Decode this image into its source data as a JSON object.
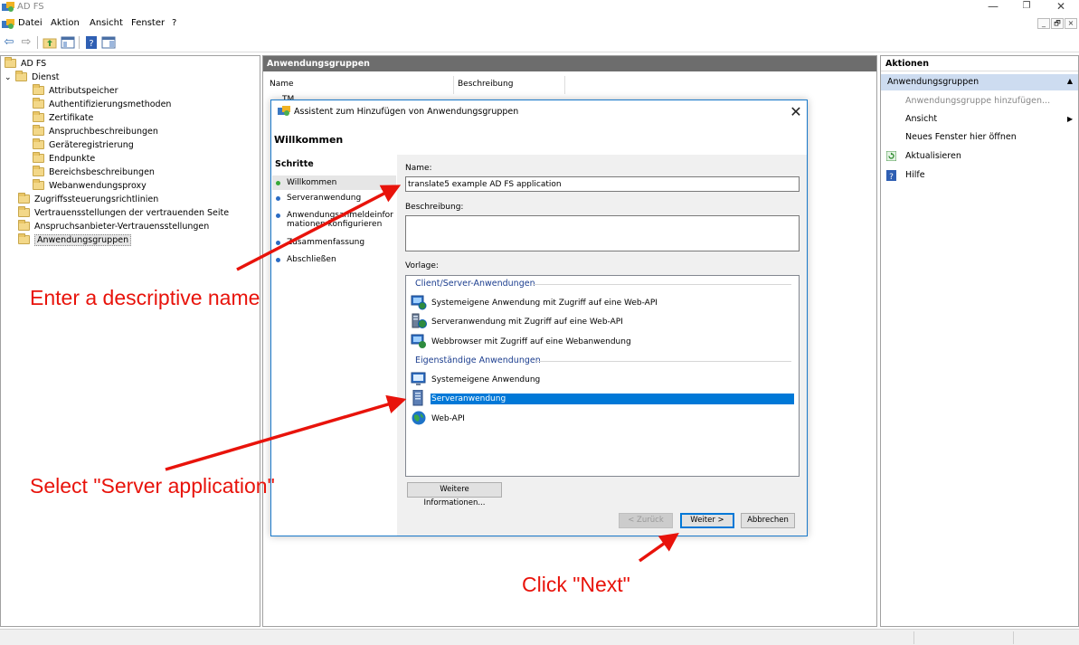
{
  "window": {
    "title": "AD FS",
    "minimize_label": "—",
    "restore_label": "❐",
    "close_label": "✕"
  },
  "menu": {
    "items": [
      "Datei",
      "Aktion",
      "Ansicht",
      "Fenster",
      "?"
    ],
    "mdi_minimize": "_",
    "mdi_restore": "🗗",
    "mdi_close": "×"
  },
  "tree": {
    "items": [
      {
        "label": "AD FS",
        "level": 0
      },
      {
        "label": "Dienst",
        "level": 1
      },
      {
        "label": "Attributspeicher",
        "level": 2
      },
      {
        "label": "Authentifizierungsmethoden",
        "level": 2
      },
      {
        "label": "Zertifikate",
        "level": 2
      },
      {
        "label": "Anspruchbeschreibungen",
        "level": 2
      },
      {
        "label": "Geräteregistrierung",
        "level": 2
      },
      {
        "label": "Endpunkte",
        "level": 2
      },
      {
        "label": "Bereichsbeschreibungen",
        "level": 2
      },
      {
        "label": "Webanwendungsproxy",
        "level": 2
      },
      {
        "label": "Zugriffssteuerungsrichtlinien",
        "level": 1
      },
      {
        "label": "Vertrauensstellungen der vertrauenden Seite",
        "level": 1
      },
      {
        "label": "Anspruchsanbieter-Vertrauensstellungen",
        "level": 1
      },
      {
        "label": "Anwendungsgruppen",
        "level": 1,
        "selected": true
      }
    ],
    "expand_glyph": "⌄"
  },
  "center": {
    "title": "Anwendungsgruppen",
    "columns": [
      "Name",
      "Beschreibung"
    ],
    "row_fragment": "TM"
  },
  "actions": {
    "title": "Aktionen",
    "section": "Anwendungsgruppen",
    "section_glyph": "▲",
    "items": [
      {
        "label": "Anwendungsgruppe hinzufügen...",
        "disabled": true
      },
      {
        "label": "Ansicht",
        "submenu": true
      },
      {
        "label": "Neues Fenster hier öffnen"
      },
      {
        "label": "Aktualisieren",
        "icon": "refresh-icon"
      },
      {
        "label": "Hilfe",
        "icon": "help-icon"
      }
    ],
    "submenu_glyph": "▶"
  },
  "wizard": {
    "title": "Assistent zum Hinzufügen von Anwendungsgruppen",
    "close_glyph": "✕",
    "heading": "Willkommen",
    "steps_title": "Schritte",
    "steps": [
      {
        "label": "Willkommen",
        "active": true
      },
      {
        "label": "Serveranwendung"
      },
      {
        "label": "Anwendungsanmeldeinformationen konfigurieren"
      },
      {
        "label": "Zusammenfassung"
      },
      {
        "label": "Abschließen"
      }
    ],
    "name_label": "Name:",
    "name_value": "translate5 example AD FS application",
    "description_label": "Beschreibung:",
    "description_value": "",
    "template_label": "Vorlage:",
    "groups": [
      {
        "title": "Client/Server-Anwendungen",
        "items": [
          {
            "label": "Systemeigene Anwendung mit Zugriff auf eine Web-API",
            "icon": "native-app-webapi-icon"
          },
          {
            "label": "Serveranwendung mit Zugriff auf eine Web-API",
            "icon": "server-app-webapi-icon"
          },
          {
            "label": "Webbrowser mit Zugriff auf eine Webanwendung",
            "icon": "browser-webapp-icon"
          }
        ]
      },
      {
        "title": "Eigenständige Anwendungen",
        "items": [
          {
            "label": "Systemeigene Anwendung",
            "icon": "native-app-icon"
          },
          {
            "label": "Serveranwendung",
            "icon": "server-app-icon",
            "selected": true
          },
          {
            "label": "Web-API",
            "icon": "web-api-icon"
          }
        ]
      }
    ],
    "more_info_button": "Weitere Informationen...",
    "back_button": "< Zurück",
    "next_button": "Weiter >",
    "cancel_button": "Abbrechen"
  },
  "annotations": {
    "name_hint": "Enter a descriptive name",
    "select_hint": "Select \"Server application\"",
    "next_hint": "Click \"Next\"",
    "color": "#e8130b"
  },
  "colors": {
    "selection": "#0078d7",
    "header_gray": "#6d6d6d",
    "actions_section": "#cddcf0",
    "wizard_border": "#1979ca"
  }
}
